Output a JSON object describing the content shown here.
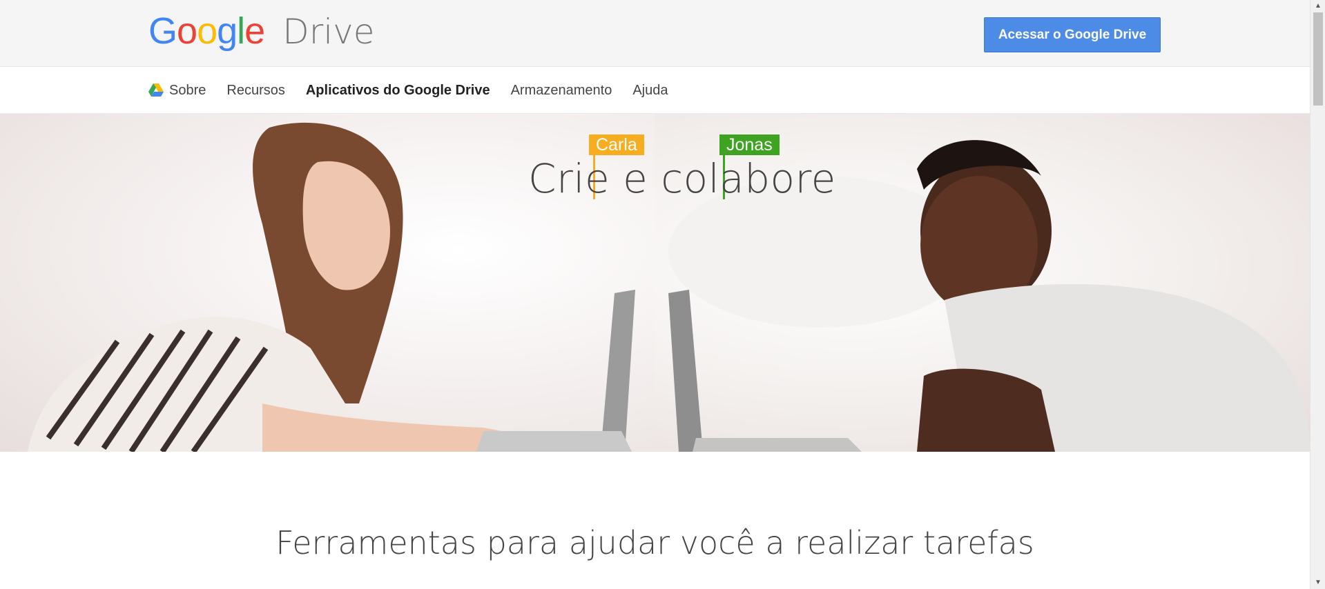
{
  "header": {
    "logo_google": "Google",
    "logo_drive": "Drive",
    "cta_label": "Acessar o Google Drive"
  },
  "nav": {
    "items": [
      {
        "label": "Sobre"
      },
      {
        "label": "Recursos"
      },
      {
        "label": "Aplicativos do Google Drive"
      },
      {
        "label": "Armazenamento"
      },
      {
        "label": "Ajuda"
      }
    ]
  },
  "hero": {
    "title": "Crie e colabore",
    "tags": [
      {
        "name": "Carla",
        "color": "#f6ad1f"
      },
      {
        "name": "Jonas",
        "color": "#3da321"
      }
    ]
  },
  "section": {
    "title": "Ferramentas para ajudar você a realizar tarefas"
  },
  "colors": {
    "primary_button": "#4d8ce6",
    "google_blue": "#4285f4",
    "google_red": "#ea4335",
    "google_yellow": "#fbbc05",
    "google_green": "#34a853"
  }
}
